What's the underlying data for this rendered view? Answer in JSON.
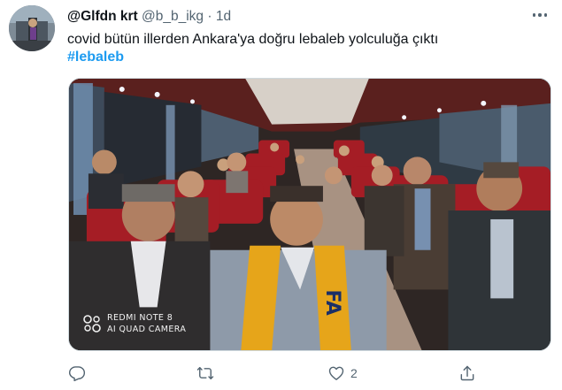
{
  "tweet": {
    "display_name": "@Glfdn krt",
    "handle": "@b_b_ikg",
    "separator": "·",
    "time": "1d",
    "text": "covid bütün illerden Ankara'ya doğru lebaleb yolculuğa çıktı",
    "hashtag": "#lebaleb"
  },
  "media": {
    "watermark_line1": "REDMI NOTE 8",
    "watermark_line2": "AI QUAD CAMERA",
    "scarf_text": "FA"
  },
  "actions": {
    "reply_icon": "reply-icon",
    "retweet_icon": "retweet-icon",
    "like_icon": "heart-icon",
    "like_count": "2",
    "share_icon": "share-icon"
  },
  "colors": {
    "accent": "#1d9bf0",
    "text_primary": "#0f1419",
    "text_secondary": "#536471"
  }
}
